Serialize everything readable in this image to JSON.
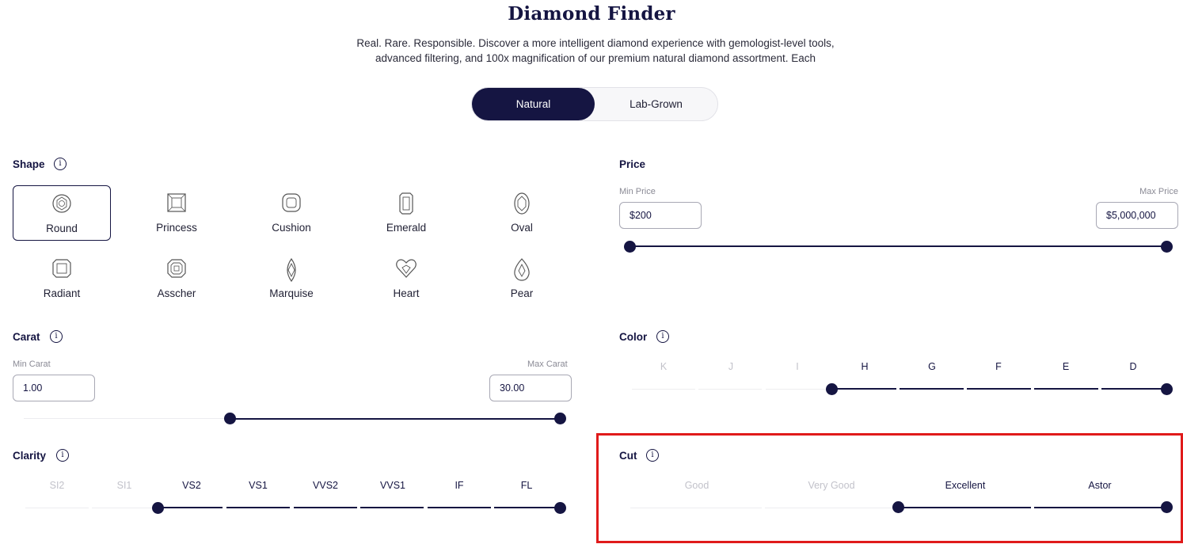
{
  "header": {
    "title": "Diamond Finder",
    "subtitle_line1": "Real. Rare. Responsible. Discover a more intelligent diamond experience with gemologist-level tools,",
    "subtitle_line2": "advanced filtering, and 100x magnification of our premium natural diamond assortment. Each"
  },
  "type_toggle": {
    "options": [
      "Natural",
      "Lab-Grown"
    ],
    "selected": "Natural"
  },
  "shape": {
    "label": "Shape",
    "selected": "Round",
    "items": [
      {
        "label": "Round",
        "icon": "round-diamond-icon"
      },
      {
        "label": "Princess",
        "icon": "princess-diamond-icon"
      },
      {
        "label": "Cushion",
        "icon": "cushion-diamond-icon"
      },
      {
        "label": "Emerald",
        "icon": "emerald-diamond-icon"
      },
      {
        "label": "Oval",
        "icon": "oval-diamond-icon"
      },
      {
        "label": "Radiant",
        "icon": "radiant-diamond-icon"
      },
      {
        "label": "Asscher",
        "icon": "asscher-diamond-icon"
      },
      {
        "label": "Marquise",
        "icon": "marquise-diamond-icon"
      },
      {
        "label": "Heart",
        "icon": "heart-diamond-icon"
      },
      {
        "label": "Pear",
        "icon": "pear-diamond-icon"
      }
    ]
  },
  "price": {
    "label": "Price",
    "min_label": "Min Price",
    "max_label": "Max Price",
    "min_value": "$200",
    "max_value": "$5,000,000"
  },
  "carat": {
    "label": "Carat",
    "min_label": "Min Carat",
    "max_label": "Max Carat",
    "min_value": "1.00",
    "max_value": "30.00"
  },
  "color": {
    "label": "Color",
    "grades": [
      "K",
      "J",
      "I",
      "H",
      "G",
      "F",
      "E",
      "D"
    ],
    "selected_from": "H",
    "selected_to": "D"
  },
  "clarity": {
    "label": "Clarity",
    "grades": [
      "SI2",
      "SI1",
      "VS2",
      "VS1",
      "VVS2",
      "VVS1",
      "IF",
      "FL"
    ],
    "selected_from": "VS2",
    "selected_to": "FL"
  },
  "cut": {
    "label": "Cut",
    "grades": [
      "Good",
      "Very Good",
      "Excellent",
      "Astor"
    ],
    "selected_from": "Excellent",
    "selected_to": "Astor"
  },
  "colors": {
    "brand_navy": "#151542",
    "highlight_red": "#e01a1a",
    "dim_text": "#c2c2ca"
  }
}
